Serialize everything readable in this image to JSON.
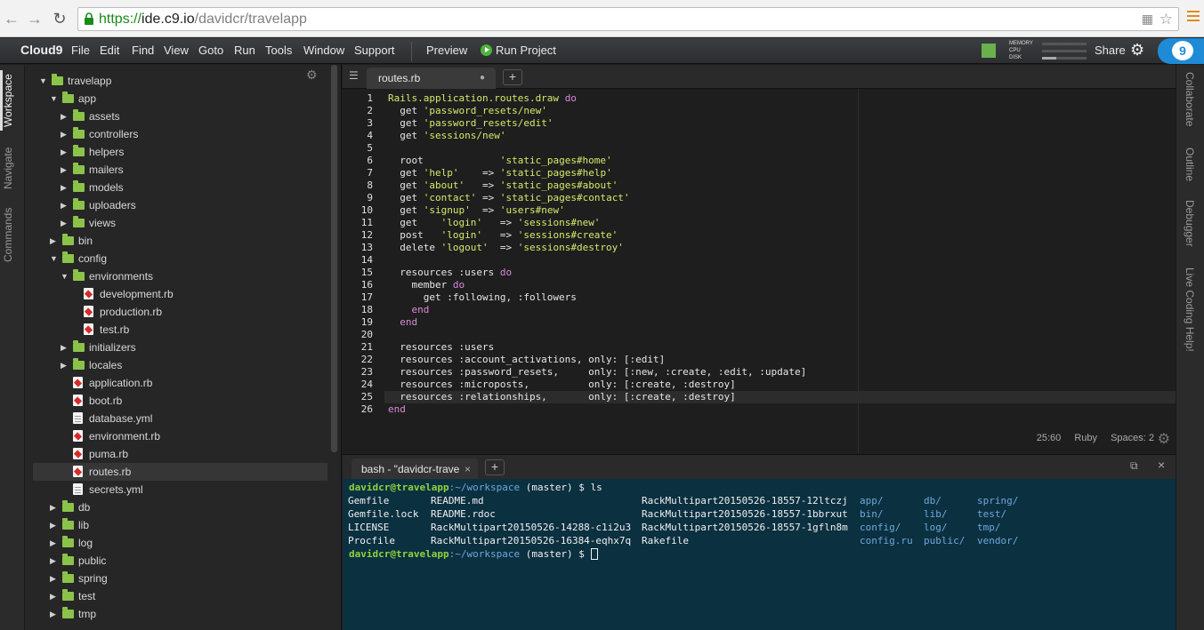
{
  "browser": {
    "url_scheme": "https://",
    "url_host": "ide.c9.io",
    "url_path": "/davidcr/travelapp"
  },
  "menu": {
    "brand": "Cloud9",
    "items": [
      "File",
      "Edit",
      "Find",
      "View",
      "Goto",
      "Run",
      "Tools",
      "Window",
      "Support"
    ],
    "preview": "Preview",
    "run_project": "Run Project",
    "share": "Share",
    "stats": {
      "memory": "MEMORY",
      "cpu": "CPU",
      "disk": "DISK"
    }
  },
  "left_tabs": [
    "Workspace",
    "Navigate",
    "Commands"
  ],
  "right_tabs": [
    "Collaborate",
    "Outline",
    "Debugger",
    "Live Coding Help!"
  ],
  "tree": [
    {
      "name": "travelapp",
      "type": "folder",
      "depth": 0,
      "open": true
    },
    {
      "name": "app",
      "type": "folder",
      "depth": 1,
      "open": true
    },
    {
      "name": "assets",
      "type": "folder",
      "depth": 2,
      "open": false
    },
    {
      "name": "controllers",
      "type": "folder",
      "depth": 2,
      "open": false
    },
    {
      "name": "helpers",
      "type": "folder",
      "depth": 2,
      "open": false
    },
    {
      "name": "mailers",
      "type": "folder",
      "depth": 2,
      "open": false
    },
    {
      "name": "models",
      "type": "folder",
      "depth": 2,
      "open": false
    },
    {
      "name": "uploaders",
      "type": "folder",
      "depth": 2,
      "open": false
    },
    {
      "name": "views",
      "type": "folder",
      "depth": 2,
      "open": false
    },
    {
      "name": "bin",
      "type": "folder",
      "depth": 1,
      "open": false
    },
    {
      "name": "config",
      "type": "folder",
      "depth": 1,
      "open": true
    },
    {
      "name": "environments",
      "type": "folder",
      "depth": 2,
      "open": true
    },
    {
      "name": "development.rb",
      "type": "rb",
      "depth": 3
    },
    {
      "name": "production.rb",
      "type": "rb",
      "depth": 3
    },
    {
      "name": "test.rb",
      "type": "rb",
      "depth": 3
    },
    {
      "name": "initializers",
      "type": "folder",
      "depth": 2,
      "open": false
    },
    {
      "name": "locales",
      "type": "folder",
      "depth": 2,
      "open": false
    },
    {
      "name": "application.rb",
      "type": "rb",
      "depth": 2
    },
    {
      "name": "boot.rb",
      "type": "rb",
      "depth": 2
    },
    {
      "name": "database.yml",
      "type": "txt",
      "depth": 2
    },
    {
      "name": "environment.rb",
      "type": "rb",
      "depth": 2
    },
    {
      "name": "puma.rb",
      "type": "rb",
      "depth": 2
    },
    {
      "name": "routes.rb",
      "type": "rb",
      "depth": 2,
      "selected": true
    },
    {
      "name": "secrets.yml",
      "type": "txt",
      "depth": 2
    },
    {
      "name": "db",
      "type": "folder",
      "depth": 1,
      "open": false
    },
    {
      "name": "lib",
      "type": "folder",
      "depth": 1,
      "open": false
    },
    {
      "name": "log",
      "type": "folder",
      "depth": 1,
      "open": false
    },
    {
      "name": "public",
      "type": "folder",
      "depth": 1,
      "open": false
    },
    {
      "name": "spring",
      "type": "folder",
      "depth": 1,
      "open": false
    },
    {
      "name": "test",
      "type": "folder",
      "depth": 1,
      "open": false
    },
    {
      "name": "tmp",
      "type": "folder",
      "depth": 1,
      "open": false
    }
  ],
  "editor": {
    "tab_title": "routes.rb",
    "lines": [
      [
        [
          "c",
          "Rails.application.routes.draw "
        ],
        [
          "k",
          "do"
        ]
      ],
      [
        [
          "w",
          "  get "
        ],
        [
          "s",
          "'password_resets/new'"
        ]
      ],
      [
        [
          "w",
          "  get "
        ],
        [
          "s",
          "'password_resets/edit'"
        ]
      ],
      [
        [
          "w",
          "  get "
        ],
        [
          "s",
          "'sessions/new'"
        ]
      ],
      [],
      [
        [
          "w",
          "  root             "
        ],
        [
          "s",
          "'static_pages#home'"
        ]
      ],
      [
        [
          "w",
          "  get "
        ],
        [
          "s",
          "'help'"
        ],
        [
          "w",
          "    => "
        ],
        [
          "s",
          "'static_pages#help'"
        ]
      ],
      [
        [
          "w",
          "  get "
        ],
        [
          "s",
          "'about'"
        ],
        [
          "w",
          "   => "
        ],
        [
          "s",
          "'static_pages#about'"
        ]
      ],
      [
        [
          "w",
          "  get "
        ],
        [
          "s",
          "'contact'"
        ],
        [
          "w",
          " => "
        ],
        [
          "s",
          "'static_pages#contact'"
        ]
      ],
      [
        [
          "w",
          "  get "
        ],
        [
          "s",
          "'signup'"
        ],
        [
          "w",
          "  => "
        ],
        [
          "s",
          "'users#new'"
        ]
      ],
      [
        [
          "w",
          "  get    "
        ],
        [
          "s",
          "'login'"
        ],
        [
          "w",
          "   => "
        ],
        [
          "s",
          "'sessions#new'"
        ]
      ],
      [
        [
          "w",
          "  post   "
        ],
        [
          "s",
          "'login'"
        ],
        [
          "w",
          "   => "
        ],
        [
          "s",
          "'sessions#create'"
        ]
      ],
      [
        [
          "w",
          "  delete "
        ],
        [
          "s",
          "'logout'"
        ],
        [
          "w",
          "  => "
        ],
        [
          "s",
          "'sessions#destroy'"
        ]
      ],
      [],
      [
        [
          "w",
          "  resources :users "
        ],
        [
          "k",
          "do"
        ]
      ],
      [
        [
          "w",
          "    member "
        ],
        [
          "k",
          "do"
        ]
      ],
      [
        [
          "w",
          "      get :following, :followers"
        ]
      ],
      [
        [
          "w",
          "    "
        ],
        [
          "k",
          "end"
        ]
      ],
      [
        [
          "w",
          "  "
        ],
        [
          "k",
          "end"
        ]
      ],
      [],
      [
        [
          "w",
          "  resources :users"
        ]
      ],
      [
        [
          "w",
          "  resources :account_activations, only: [:edit]"
        ]
      ],
      [
        [
          "w",
          "  resources :password_resets,     only: [:new, :create, :edit, :update]"
        ]
      ],
      [
        [
          "w",
          "  resources :microposts,          only: [:create, :destroy]"
        ]
      ],
      [
        [
          "w",
          "  resources :relationships,       only: [:create, :destroy]"
        ]
      ],
      [
        [
          "k",
          "end"
        ]
      ]
    ],
    "status": {
      "position": "25:60",
      "language": "Ruby",
      "spaces": "Spaces: 2"
    }
  },
  "terminal": {
    "tab_title": "bash - \"davidcr-trave",
    "prompt_user": "davidcr@travelapp",
    "prompt_path": ":~/workspace",
    "prompt_branch": " (master) $ ",
    "command": "ls",
    "columns": [
      {
        "color": "#f0f0f0",
        "items": [
          "Gemfile",
          "Gemfile.lock",
          "LICENSE",
          "Procfile"
        ]
      },
      {
        "color": "#f0f0f0",
        "items": [
          "README.md",
          "README.rdoc",
          "RackMultipart20150526-14288-c1i2u3",
          "RackMultipart20150526-16384-eqhx7q"
        ]
      },
      {
        "color": "#f0f0f0",
        "items": [
          "RackMultipart20150526-18557-12ltczj",
          "RackMultipart20150526-18557-1bbrxut",
          "RackMultipart20150526-18557-1gfln8m",
          "Rakefile"
        ]
      },
      {
        "color": "#6fa8dc",
        "items": [
          "app/",
          "bin/",
          "config/",
          "config.ru"
        ]
      },
      {
        "color": "#6fa8dc",
        "items": [
          "db/",
          "lib/",
          "log/",
          "public/"
        ]
      },
      {
        "color": "#6fa8dc",
        "items": [
          "spring/",
          "test/",
          "tmp/",
          "vendor/"
        ]
      }
    ]
  },
  "colors": {
    "accent": "#1f8ad6",
    "folder": "#8bc34a",
    "string": "#d6e96a",
    "keyword": "#d88ad8",
    "prompt": "#8fd33b"
  }
}
